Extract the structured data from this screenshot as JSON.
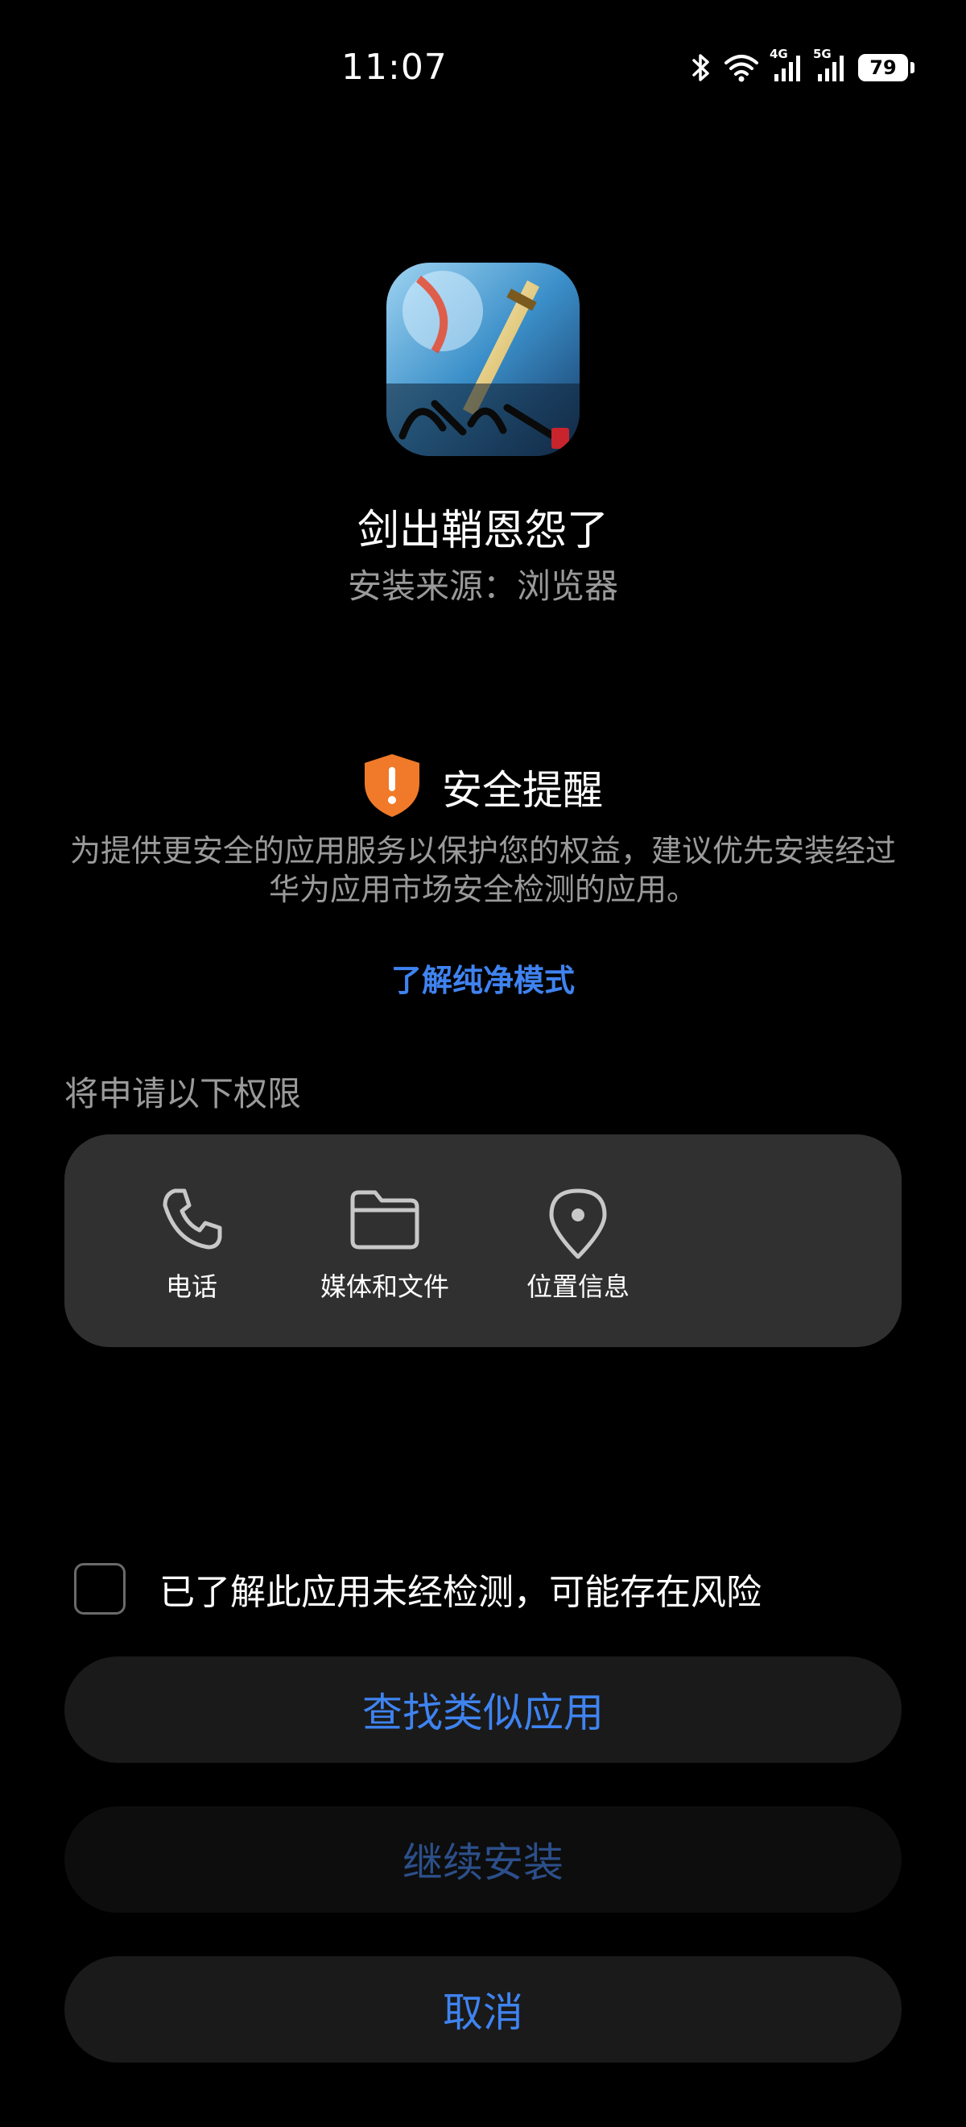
{
  "status_bar": {
    "time": "11:07",
    "battery": "79",
    "network_1": "4G",
    "network_2": "5G",
    "icons": [
      "bluetooth-icon",
      "wifi-icon",
      "signal-4g-icon",
      "signal-5g-icon",
      "battery-icon"
    ]
  },
  "app": {
    "name": "剑出鞘恩怨了",
    "source": "安装来源：浏览器",
    "icon": "app-icon-sword"
  },
  "security": {
    "title": "安全提醒",
    "description": "为提供更安全的应用服务以保护您的权益，建议优先安装经过华为应用市场安全检测的应用。",
    "learn_more": "了解纯净模式",
    "icon": "shield-warning-icon"
  },
  "permissions": {
    "title": "将申请以下权限",
    "items": [
      {
        "label": "电话",
        "icon": "phone-icon"
      },
      {
        "label": "媒体和文件",
        "icon": "folder-icon"
      },
      {
        "label": "位置信息",
        "icon": "location-pin-icon"
      }
    ]
  },
  "actions": {
    "risk_ack": "已了解此应用未经检测，可能存在风险",
    "find_similar": "查找类似应用",
    "continue_install": "继续安装",
    "cancel": "取消"
  },
  "colors": {
    "background": "#000000",
    "accent": "#3f83f0",
    "warning": "#f07a2a",
    "card": "#303030",
    "button": "#1a1a1a"
  }
}
